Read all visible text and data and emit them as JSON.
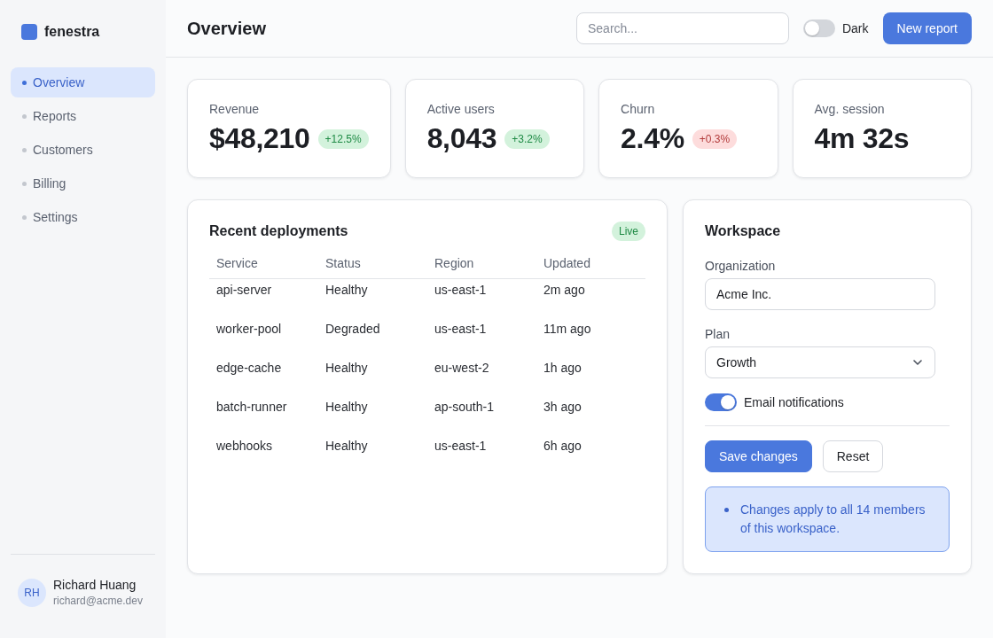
{
  "sidebar": {
    "brand": "fenestra",
    "items": [
      {
        "label": "Overview",
        "selected": true
      },
      {
        "label": "Reports",
        "selected": false
      },
      {
        "label": "Customers",
        "selected": false
      },
      {
        "label": "Billing",
        "selected": false
      },
      {
        "label": "Settings",
        "selected": false
      }
    ],
    "user": {
      "initials": "RH",
      "name": "Richard Huang",
      "email": "richard@acme.dev"
    }
  },
  "header": {
    "title": "Overview",
    "search": {
      "placeholder": "Search..."
    },
    "dark_toggle": {
      "label": "Dark",
      "on": false
    },
    "primary_button": "New report"
  },
  "stats": [
    {
      "label": "Revenue",
      "value": "$48,210",
      "delta": {
        "text": "+12.5%",
        "kind": "positive"
      }
    },
    {
      "label": "Active users",
      "value": "8,043",
      "delta": {
        "text": "+3.2%",
        "kind": "positive"
      }
    },
    {
      "label": "Churn",
      "value": "2.4%",
      "delta": {
        "text": "+0.3%",
        "kind": "negative"
      }
    },
    {
      "label": "Avg. session",
      "value": "4m 32s"
    }
  ],
  "deployments": {
    "title": "Recent deployments",
    "badge": "Live",
    "table": {
      "columns": [
        "Service",
        "Status",
        "Region",
        "Updated"
      ],
      "rows": [
        [
          "api-server",
          "Healthy",
          "us-east-1",
          "2m ago"
        ],
        [
          "worker-pool",
          "Degraded",
          "us-east-1",
          "11m ago"
        ],
        [
          "edge-cache",
          "Healthy",
          "eu-west-2",
          "1h ago"
        ],
        [
          "batch-runner",
          "Healthy",
          "ap-south-1",
          "3h ago"
        ],
        [
          "webhooks",
          "Healthy",
          "us-east-1",
          "6h ago"
        ]
      ]
    }
  },
  "workspace": {
    "title": "Workspace",
    "fields": [
      {
        "kind": "text",
        "label": "Organization",
        "value": "Acme Inc."
      },
      {
        "kind": "select",
        "label": "Plan",
        "value": "Growth"
      }
    ],
    "toggle": {
      "label": "Email notifications",
      "on": true
    },
    "buttons": [
      {
        "label": "Save changes",
        "kind": "primary"
      },
      {
        "label": "Reset",
        "kind": "secondary"
      }
    ],
    "notes": [
      "Changes apply to all 14 members of this workspace."
    ]
  }
}
